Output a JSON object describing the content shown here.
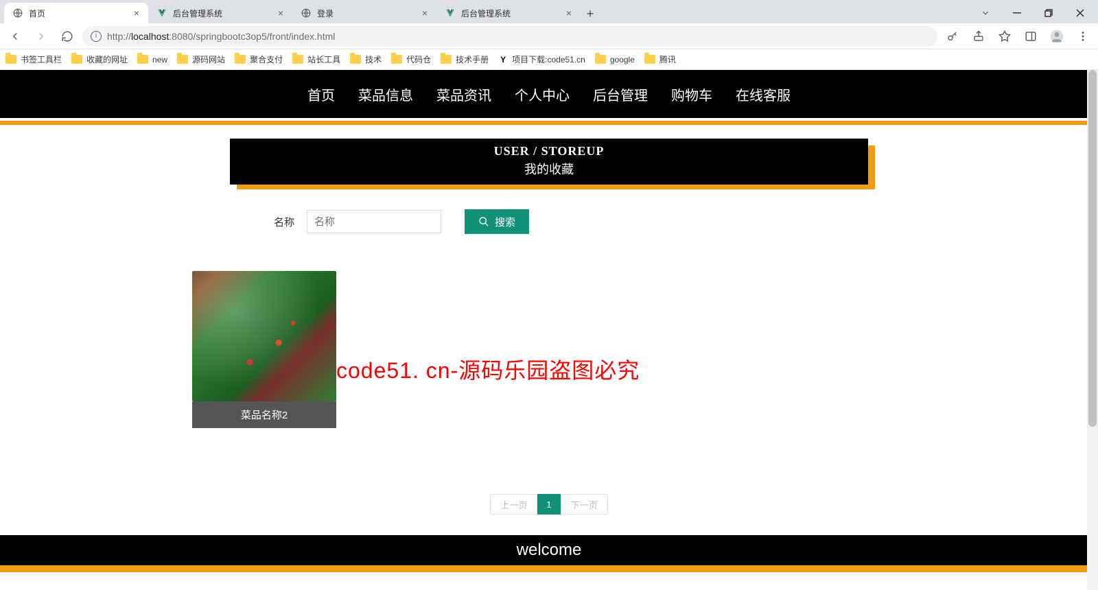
{
  "browser": {
    "tabs": [
      {
        "label": "首页",
        "favicon": "globe"
      },
      {
        "label": "后台管理系统",
        "favicon": "vue"
      },
      {
        "label": "登录",
        "favicon": "globe"
      },
      {
        "label": "后台管理系统",
        "favicon": "vue"
      }
    ],
    "url_host": "localhost",
    "url_port": ":8080",
    "url_path": "/springbootc3op5/front/index.html",
    "url_prefix": "http://"
  },
  "bookmarks": [
    {
      "label": "书签工具栏",
      "icon": "folder"
    },
    {
      "label": "收藏的网址",
      "icon": "folder"
    },
    {
      "label": "new",
      "icon": "folder"
    },
    {
      "label": "源码网站",
      "icon": "folder"
    },
    {
      "label": "聚合支付",
      "icon": "folder"
    },
    {
      "label": "站长工具",
      "icon": "folder"
    },
    {
      "label": "技术",
      "icon": "folder"
    },
    {
      "label": "代码仓",
      "icon": "folder"
    },
    {
      "label": "技术手册",
      "icon": "folder"
    },
    {
      "label": "项目下载:code51.cn",
      "icon": "link"
    },
    {
      "label": "google",
      "icon": "folder"
    },
    {
      "label": "腾讯",
      "icon": "folder"
    }
  ],
  "nav": {
    "items": [
      "首页",
      "菜品信息",
      "菜品资讯",
      "个人中心",
      "后台管理",
      "购物车",
      "在线客服"
    ]
  },
  "section": {
    "en": "USER / STOREUP",
    "zh": "我的收藏"
  },
  "search": {
    "label": "名称",
    "placeholder": "名称",
    "button": "搜索",
    "value": ""
  },
  "items": [
    {
      "name": "菜品名称2"
    }
  ],
  "watermark": "code51. cn-源码乐园盗图必究",
  "pagination": {
    "prev": "上一页",
    "next": "下一页",
    "pages": [
      "1"
    ],
    "active": 0
  },
  "footer": "welcome"
}
